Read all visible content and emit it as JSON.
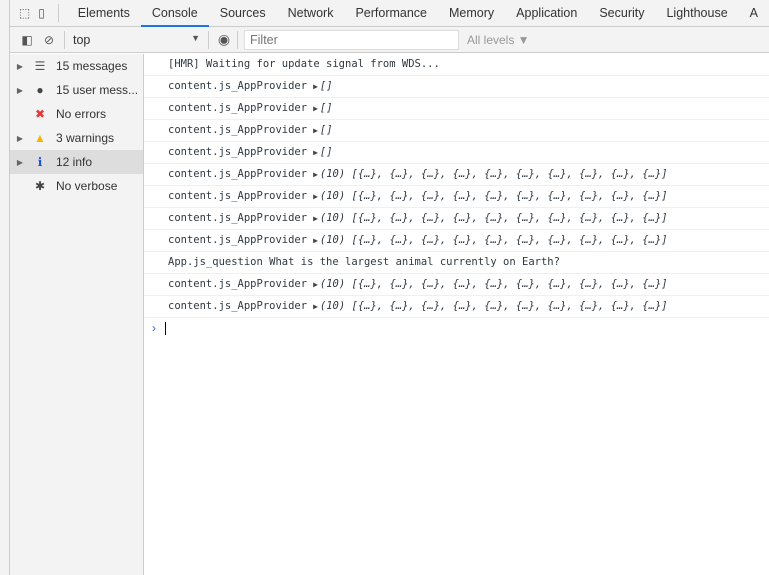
{
  "tabs": [
    "Elements",
    "Console",
    "Sources",
    "Network",
    "Performance",
    "Memory",
    "Application",
    "Security",
    "Lighthouse",
    "A"
  ],
  "toolbar": {
    "context": "top",
    "filter_placeholder": "Filter",
    "levels": "All levels ▼"
  },
  "sidebar": [
    {
      "label": "15 messages",
      "icon": "list-icon",
      "glyph": "☰",
      "color": "#555",
      "arrow": true
    },
    {
      "label": "15 user mess...",
      "icon": "user-icon",
      "glyph": "●",
      "color": "#444",
      "arrow": true
    },
    {
      "label": "No errors",
      "icon": "error-icon",
      "glyph": "✖",
      "color": "#e53935",
      "arrow": false
    },
    {
      "label": "3 warnings",
      "icon": "warning-icon",
      "glyph": "▲",
      "color": "#f4b400",
      "arrow": true
    },
    {
      "label": "12 info",
      "icon": "info-icon",
      "glyph": "ℹ",
      "color": "#1a4fd6",
      "arrow": true,
      "selected": true
    },
    {
      "label": "No verbose",
      "icon": "bug-icon",
      "glyph": "✱",
      "color": "#444",
      "arrow": false
    }
  ],
  "messages": [
    {
      "text": "[HMR] Waiting for update signal from WDS...",
      "obj": ""
    },
    {
      "text": "content.js_AppProvider",
      "obj": "[]"
    },
    {
      "text": "content.js_AppProvider",
      "obj": "[]"
    },
    {
      "text": "content.js_AppProvider",
      "obj": "[]"
    },
    {
      "text": "content.js_AppProvider",
      "obj": "[]"
    },
    {
      "text": "content.js_AppProvider",
      "obj": "(10) [{…}, {…}, {…}, {…}, {…}, {…}, {…}, {…}, {…}, {…}]"
    },
    {
      "text": "content.js_AppProvider",
      "obj": "(10) [{…}, {…}, {…}, {…}, {…}, {…}, {…}, {…}, {…}, {…}]"
    },
    {
      "text": "content.js_AppProvider",
      "obj": "(10) [{…}, {…}, {…}, {…}, {…}, {…}, {…}, {…}, {…}, {…}]"
    },
    {
      "text": "content.js_AppProvider",
      "obj": "(10) [{…}, {…}, {…}, {…}, {…}, {…}, {…}, {…}, {…}, {…}]"
    },
    {
      "text": "App.js_question What is the largest animal currently on Earth?",
      "obj": ""
    },
    {
      "text": "content.js_AppProvider",
      "obj": "(10) [{…}, {…}, {…}, {…}, {…}, {…}, {…}, {…}, {…}, {…}]"
    },
    {
      "text": "content.js_AppProvider",
      "obj": "(10) [{…}, {…}, {…}, {…}, {…}, {…}, {…}, {…}, {…}, {…}]"
    }
  ],
  "prompt": "›"
}
